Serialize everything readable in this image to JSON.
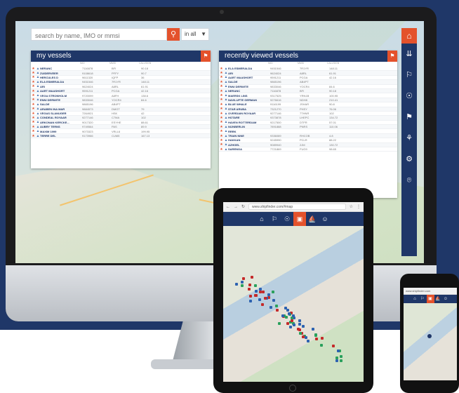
{
  "search": {
    "placeholder": "search by name, IMO or mmsi",
    "filter_value": "in all"
  },
  "toolbar": {
    "home_icon": "home-icon",
    "items": [
      "⇊",
      "⚐",
      "☉",
      "⚑",
      "⚘",
      "⚙",
      "⌾"
    ]
  },
  "my_vessels": {
    "title": "my vessels",
    "columns": [
      "",
      "IMO",
      "MMSI",
      "CALLSIGN",
      "CLASS"
    ],
    "rows": [
      {
        "name": "NERANC",
        "c1": "7116878",
        "c2": "BFI",
        "c3": "90.18"
      },
      {
        "name": "ZUIDERVEER",
        "c1": "9108618",
        "c2": "PFFY",
        "c3": "90.7"
      },
      {
        "name": "HERCULES D",
        "c1": "9611320",
        "c2": "IQFP",
        "c3": "36"
      },
      {
        "name": "ELA ESMERALDA",
        "c1": "9451546",
        "c2": "7R1YR",
        "c3": "148.11"
      },
      {
        "name": "ARI",
        "c1": "9624024",
        "c2": "A8RL",
        "c3": "61.91"
      },
      {
        "name": "AART MAASHORT",
        "c1": "9591211",
        "c2": "PCGA",
        "c3": "42.16"
      },
      {
        "name": "VEGA STRONHOLM",
        "c1": "9720099",
        "c2": "A8FH",
        "c3": "138.6"
      },
      {
        "name": "ENNI DERWITE",
        "c1": "9833046",
        "c2": "YOCR4",
        "c3": "84.6"
      },
      {
        "name": "SALDE",
        "c1": "9865196",
        "c2": "AB4PT",
        "c3": ""
      },
      {
        "name": "ARABEN INA MAR",
        "c1": "9884573",
        "c2": "DMGT",
        "c3": "79"
      },
      {
        "name": "VEGAS SLANUGER",
        "c1": "7264921",
        "c2": "HSK",
        "c3": "42"
      },
      {
        "name": "CONDEAL ROYAAR",
        "c1": "9277146",
        "c2": "C7MA",
        "c3": "102"
      },
      {
        "name": "ARKONAN KERCKE...",
        "c1": "9017320",
        "c2": "ESYHE",
        "c3": "88.61"
      },
      {
        "name": "AUBRY TERNS",
        "c1": "9749564",
        "c2": "PAS",
        "c3": "89.9"
      },
      {
        "name": "MAXIM 1999",
        "c1": "9073323",
        "c2": "VRLL6",
        "c3": "199.95"
      },
      {
        "name": "TERRE DEL",
        "c1": "9173966",
        "c2": "CUM5",
        "c3": "167.13"
      }
    ]
  },
  "recently_viewed": {
    "title": "recently viewed vessels",
    "columns": [
      "",
      "IMO",
      "MMSI",
      "CALLSIGN",
      "CLASS"
    ],
    "rows": [
      {
        "name": "ELA ESMERALDA",
        "c1": "9451546",
        "c2": "7R1YR",
        "c3": "148.11"
      },
      {
        "name": "ARI",
        "c1": "9624024",
        "c2": "A8RL",
        "c3": "61.91"
      },
      {
        "name": "AART MAASHORT",
        "c1": "9591211",
        "c2": "PCGA",
        "c3": "42.16"
      },
      {
        "name": "SALDE",
        "c1": "9865196",
        "c2": "AB4PT",
        "c3": ""
      },
      {
        "name": "ENNI DERWITE",
        "c1": "9833046",
        "c2": "YOCR4",
        "c3": "84.6"
      },
      {
        "name": "NERANC",
        "c1": "7116878",
        "c2": "BFI",
        "c3": "90.18"
      },
      {
        "name": "MAERSK LINS",
        "c1": "9317525",
        "c2": "YRN1B",
        "c3": "100.95"
      },
      {
        "name": "NAVILUFTE GERMAN",
        "c1": "9276616",
        "c2": "NDH8",
        "c3": "210.41"
      },
      {
        "name": "BLUE WHALE",
        "c1": "9116199",
        "c2": "JSHAR",
        "c3": "90.8"
      },
      {
        "name": "STAR ARUBA",
        "c1": "7321270",
        "c2": "PHSY",
        "c3": "76.06"
      },
      {
        "name": "OVERDAIN ROYAAR",
        "c1": "9277146",
        "c2": "7THNR",
        "c3": "102"
      },
      {
        "name": "HOTARE",
        "c1": "9373878",
        "c2": "LHEPC",
        "c3": "134.72"
      },
      {
        "name": "HAVEN ROTTERDAM",
        "c1": "9217500",
        "c2": "DTFR",
        "c3": "57.01"
      },
      {
        "name": "NIJNBERLIN",
        "c1": "7891888",
        "c2": "PNRS",
        "c3": "110.06"
      },
      {
        "name": "RRRK",
        "c1": "",
        "c2": "",
        "c3": ""
      },
      {
        "name": "TRAIN NINE",
        "c1": "9336089",
        "c2": "RHCOB",
        "c3": "4.8"
      },
      {
        "name": "HAKKAN",
        "c1": "9245990",
        "c2": "PCLR",
        "c3": "88.22"
      },
      {
        "name": "AZHGEL",
        "c1": "9089940",
        "c2": "2JM",
        "c3": "130.72"
      },
      {
        "name": "SARENGA",
        "c1": "7721869",
        "c2": "FUG9",
        "c3": "98.65"
      }
    ]
  },
  "tablet": {
    "url": "www.shipfinder.com/#map",
    "nav_icons": [
      "⌂",
      "⚐",
      "☉",
      "▣",
      "⛵",
      "☺"
    ]
  },
  "phone": {
    "url": "www.shipfinder.com",
    "nav_icons": [
      "⌂",
      "⚐",
      "▣",
      "⛵",
      "☺"
    ]
  },
  "colors": {
    "navy": "#1f3768",
    "accent": "#e4522c",
    "vessel_red": "#c42a2a",
    "vessel_green": "#2aa05c",
    "vessel_blue": "#2d62b0"
  }
}
